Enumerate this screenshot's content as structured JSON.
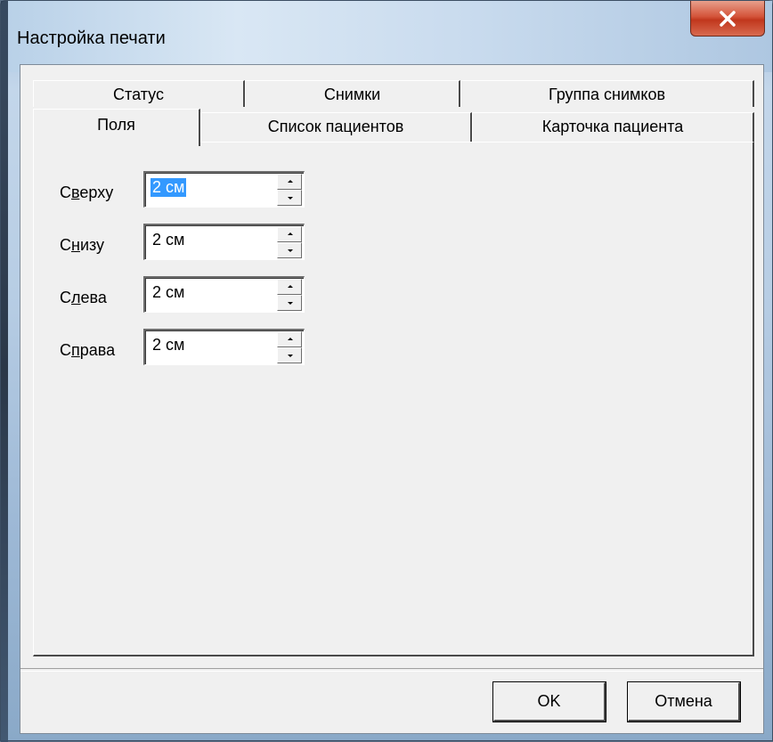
{
  "window": {
    "title": "Настройка печати",
    "close_glyph": "x"
  },
  "tabs": {
    "row_top": [
      "Статус",
      "Снимки",
      "Группа снимков"
    ],
    "row_bottom": [
      "Поля",
      "Список пациентов",
      "Карточка пациента"
    ],
    "active": "Поля"
  },
  "fields": [
    {
      "label_pre": "С",
      "label_underline": "в",
      "label_post": "ерху",
      "value": "2 см",
      "selected": true
    },
    {
      "label_pre": "С",
      "label_underline": "н",
      "label_post": "изу",
      "value": "2 см",
      "selected": false
    },
    {
      "label_pre": "С",
      "label_underline": "л",
      "label_post": "ева",
      "value": "2 см",
      "selected": false
    },
    {
      "label_pre": "С",
      "label_underline": "п",
      "label_post": "рава",
      "value": "2 см",
      "selected": false
    }
  ],
  "buttons": {
    "ok": "OK",
    "cancel": "Отмена"
  },
  "colors": {
    "selection": "#3399ff",
    "close_button": "#c1371d"
  }
}
